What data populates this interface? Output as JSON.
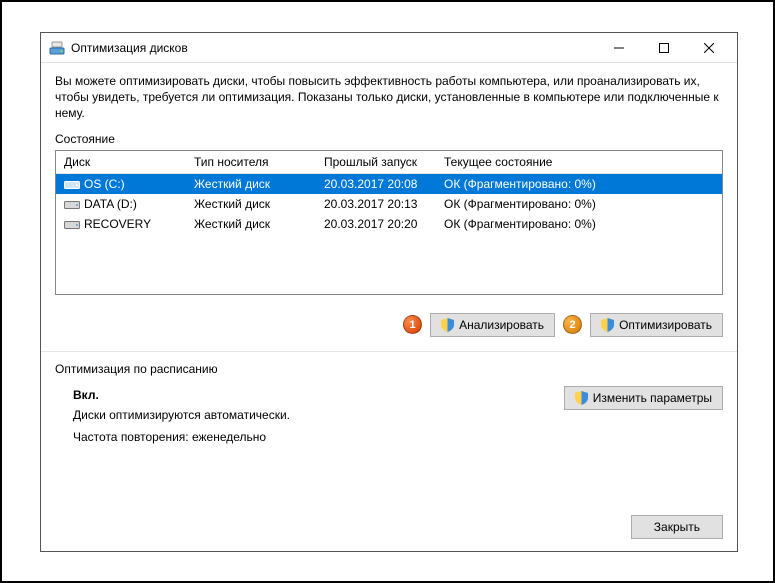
{
  "window": {
    "title": "Оптимизация дисков"
  },
  "intro": "Вы можете оптимизировать диски, чтобы повысить эффективность работы  компьютера, или проанализировать их, чтобы увидеть, требуется ли оптимизация. Показаны только диски, установленные в компьютере или подключенные к нему.",
  "status_label": "Состояние",
  "table": {
    "headers": {
      "disk": "Диск",
      "media": "Тип носителя",
      "last_run": "Прошлый запуск",
      "current": "Текущее состояние"
    },
    "rows": [
      {
        "name": "OS (C:)",
        "media": "Жесткий диск",
        "last": "20.03.2017 20:08",
        "state": "ОК (Фрагментировано: 0%)",
        "selected": true
      },
      {
        "name": "DATA (D:)",
        "media": "Жесткий диск",
        "last": "20.03.2017 20:13",
        "state": "ОК (Фрагментировано: 0%)",
        "selected": false
      },
      {
        "name": "RECOVERY",
        "media": "Жесткий диск",
        "last": "20.03.2017 20:20",
        "state": "ОК (Фрагментировано: 0%)",
        "selected": false
      }
    ]
  },
  "buttons": {
    "analyze": "Анализировать",
    "optimize": "Оптимизировать",
    "change_settings": "Изменить параметры",
    "close": "Закрыть"
  },
  "callouts": {
    "analyze_num": "1",
    "optimize_num": "2"
  },
  "schedule": {
    "label": "Оптимизация по расписанию",
    "state_title": "Вкл.",
    "auto_line": "Диски оптимизируются автоматически.",
    "freq_line": "Частота повторения: еженедельно"
  }
}
